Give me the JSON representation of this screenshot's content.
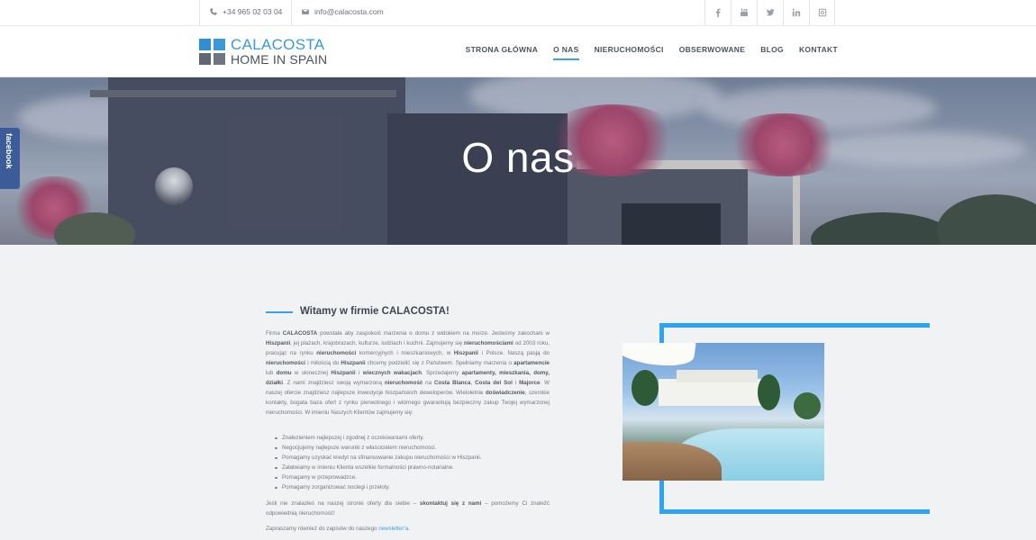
{
  "topbar": {
    "phone": "+34 965 02 03 04",
    "email": "info@calacosta.com",
    "social_icons": [
      "facebook-icon",
      "youtube-icon",
      "twitter-icon",
      "linkedin-icon",
      "instagram-icon"
    ]
  },
  "logo": {
    "line1": "CALACOSTA",
    "line2": "HOME IN SPAIN",
    "colors": [
      "#2e8fd3",
      "#3a9ad9",
      "#5f6872",
      "#6e7781"
    ]
  },
  "nav": {
    "items": [
      {
        "label": "STRONA GŁÓWNA",
        "active": false
      },
      {
        "label": "O NAS",
        "active": true
      },
      {
        "label": "NIERUCHOMOŚCI",
        "active": false
      },
      {
        "label": "OBSERWOWANE",
        "active": false
      },
      {
        "label": "BLOG",
        "active": false
      },
      {
        "label": "KONTAKT",
        "active": false
      }
    ]
  },
  "hero": {
    "title": "O nas"
  },
  "facebook_tab": {
    "label": "facebook"
  },
  "content": {
    "heading": "Witamy w firmie CALACOSTA!",
    "paragraph1": {
      "t1": "Firma ",
      "b1": "CALACOSTA",
      "t2": " powstała aby zaspokoić marzenia o domu z widokiem na morze. Jesteśmy zakochani w ",
      "b2": "Hiszpanii",
      "t3": ", jej plażach, krajobrazach, kulturze, ludziach i kuchni. Zajmujemy się ",
      "b3": "nieruchomościami",
      "t4": " od 2003 roku, pracując na rynku ",
      "b4": "nieruchomości",
      "t5": " komercyjnych i mieszkaniowych, w ",
      "b5": "Hiszpanii",
      "t6": " i Polsce. Naszą pasją do ",
      "b6": "nieruchomości",
      "t7": " i miłością do ",
      "b7": "Hiszpanii",
      "t8": " chcemy podzielić się z Państwem. Spełniamy marzenia o ",
      "b8": "apartamencie",
      "t9": " lub ",
      "b9": "domu",
      "t10": " w słonecznej ",
      "b10": "Hiszpanii",
      "t11": " i ",
      "b11": "wiecznych wakacjach",
      "t12": ". Sprzedajemy ",
      "b12": "apartamenty, mieszkania, domy, działki",
      "t13": ". Z nami znajdziesz swoją wymarzoną ",
      "b13": "nieruchomość",
      "t14": " na ",
      "b14": "Costa Blanca",
      "t15": ", ",
      "b15": "Costa del Sol",
      "t16": " i ",
      "b16": "Majorce",
      "t17": ". W naszej ofercie znajdziesz najlepsze inwestycje hiszpańskich deweloperów. Wieloletnie ",
      "b17": "doświadczenie",
      "t18": ", szerokie kontakty, bogata baza ofert z rynku pierwotnego i wtórnego gwarantują bezpieczny zakup Twojej wymarzonej nieruchomości. W imieniu Naszych Klientów zajmujemy się:"
    },
    "bullets": [
      "Znalezieniem najlepszej i zgodnej z oczekiwaniami oferty.",
      "Negocjujemy najlepsze warunki z właścicielem nieruchomości.",
      "Pomagamy uzyskać kredyt na sfinansowanie zakupu nieruchomości w Hiszpanii.",
      "Załatwiamy w imieniu Klienta wszelkie formalności prawno-notarialne.",
      "Pomagamy w przeprowadzce.",
      "Pomagamy zorganizować noclegi i przeloty."
    ],
    "paragraph2": {
      "t1": "Jeśli nie znalazłeś na naszej stronie oferty dla siebie – ",
      "b1": "skontaktuj się z nami",
      "t2": " – pomożemy Ci znaleźć odpowiednią nieruchomość!"
    },
    "paragraph3": {
      "t1": "Zapraszamy również do zapisów do naszego ",
      "link": "newsletter'a",
      "t2": "."
    },
    "accent_color": "#2ea3f2"
  }
}
